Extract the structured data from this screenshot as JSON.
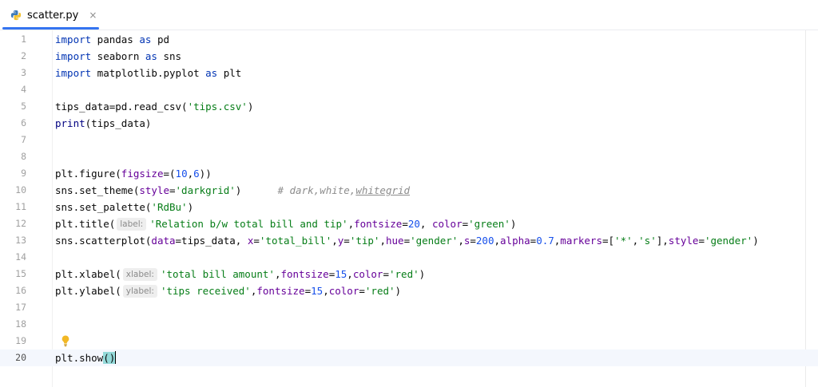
{
  "tab": {
    "icon": "python-file-icon",
    "label": "scatter.py",
    "close_glyph": "×",
    "accent": "#3574f0"
  },
  "editor": {
    "current_line": 20,
    "lines": [
      {
        "n": "1"
      },
      {
        "n": "2"
      },
      {
        "n": "3"
      },
      {
        "n": "4"
      },
      {
        "n": "5"
      },
      {
        "n": "6"
      },
      {
        "n": "7"
      },
      {
        "n": "8"
      },
      {
        "n": "9"
      },
      {
        "n": "10"
      },
      {
        "n": "11"
      },
      {
        "n": "12"
      },
      {
        "n": "13"
      },
      {
        "n": "14"
      },
      {
        "n": "15"
      },
      {
        "n": "16"
      },
      {
        "n": "17"
      },
      {
        "n": "18"
      },
      {
        "n": "19"
      },
      {
        "n": "20"
      }
    ],
    "code": {
      "l1_kw1": "import",
      "l1_mod": " pandas ",
      "l1_kw2": "as",
      "l1_alias": " pd",
      "l2_kw1": "import",
      "l2_mod": " seaborn ",
      "l2_kw2": "as",
      "l2_alias": " sns",
      "l3_kw1": "import",
      "l3_mod": " matplotlib.pyplot ",
      "l3_kw2": "as",
      "l3_alias": " plt",
      "l5_a": "tips_data=pd.read_csv(",
      "l5_str": "'tips.csv'",
      "l5_b": ")",
      "l6_fn": "print",
      "l6_b": "(tips_data)",
      "l9_a": "plt.figure(",
      "l9_p": "figsize",
      "l9_b": "=(",
      "l9_n1": "10",
      "l9_c": ",",
      "l9_n2": "6",
      "l9_d": "))",
      "l10_a": "sns.set_theme(",
      "l10_p": "style",
      "l10_b": "=",
      "l10_str": "'darkgrid'",
      "l10_c": ")",
      "l10_cmt1": "# dark,white,",
      "l10_cmt2": "whitegrid",
      "l11_a": "sns.set_palette(",
      "l11_str": "'RdBu'",
      "l11_b": ")",
      "l12_a": "plt.title(",
      "l12_hint": "label:",
      "l12_str1": "'Relation b/w total bill and tip'",
      "l12_b": ",",
      "l12_p1": "fontsize",
      "l12_c": "=",
      "l12_n": "20",
      "l12_d": ", ",
      "l12_p2": "color",
      "l12_e": "=",
      "l12_str2": "'green'",
      "l12_f": ")",
      "l13_a": "sns.scatterplot(",
      "l13_p1": "data",
      "l13_b": "=tips_data, ",
      "l13_p2": "x",
      "l13_c": "=",
      "l13_s1": "'total_bill'",
      "l13_d": ",",
      "l13_p3": "y",
      "l13_e": "=",
      "l13_s2": "'tip'",
      "l13_f": ",",
      "l13_p4": "hue",
      "l13_g": "=",
      "l13_s3": "'gender'",
      "l13_h": ",",
      "l13_p5": "s",
      "l13_i": "=",
      "l13_n1": "200",
      "l13_j": ",",
      "l13_p6": "alpha",
      "l13_k": "=",
      "l13_n2": "0.7",
      "l13_l": ",",
      "l13_p7": "markers",
      "l13_m": "=[",
      "l13_s4": "'*'",
      "l13_n": ",",
      "l13_s5": "'s'",
      "l13_o": "],",
      "l13_p8": "style",
      "l13_q": "=",
      "l13_s6": "'gender'",
      "l13_r": ")",
      "l15_a": "plt.xlabel(",
      "l15_hint": "xlabel:",
      "l15_s1": "'total bill amount'",
      "l15_b": ",",
      "l15_p1": "fontsize",
      "l15_c": "=",
      "l15_n": "15",
      "l15_d": ",",
      "l15_p2": "color",
      "l15_e": "=",
      "l15_s2": "'red'",
      "l15_f": ")",
      "l16_a": "plt.ylabel(",
      "l16_hint": "ylabel:",
      "l16_s1": "'tips received'",
      "l16_b": ",",
      "l16_p1": "fontsize",
      "l16_c": "=",
      "l16_n": "15",
      "l16_d": ",",
      "l16_p2": "color",
      "l16_e": "=",
      "l16_s2": "'red'",
      "l16_f": ")",
      "l20_a": "plt.show",
      "l20_b": "()"
    },
    "intention_bulb": "lightbulb-icon"
  }
}
